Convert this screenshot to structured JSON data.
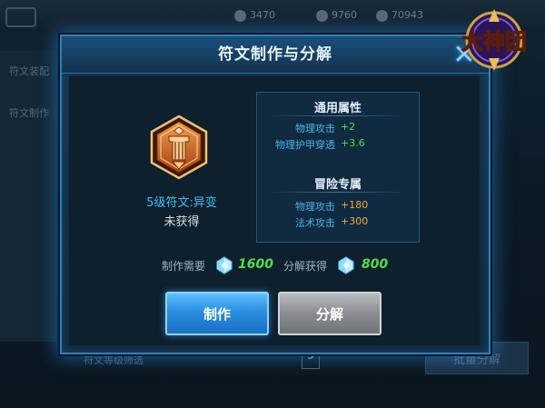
{
  "background": {
    "resources": [
      "3470",
      "9760",
      "70943"
    ],
    "sidebar_items": [
      "符文装配",
      "符文制作"
    ],
    "level_filter_label": "符文等级筛选",
    "level_filter_selected": "5",
    "batch_button": "批量分解"
  },
  "dialog": {
    "title": "符文制作与分解",
    "rune": {
      "name": "5级符文:异变",
      "status": "未获得",
      "icon": "rune-hexagon-icon",
      "color": "#d2691e"
    },
    "general_attributes": {
      "title": "通用属性",
      "rows": [
        {
          "name": "物理攻击",
          "value": "+2"
        },
        {
          "name": "物理护甲穿透",
          "value": "+3.6"
        }
      ]
    },
    "adventure_attributes": {
      "title": "冒险专属",
      "rows": [
        {
          "name": "物理攻击",
          "value": "+180"
        },
        {
          "name": "法术攻击",
          "value": "+300"
        }
      ]
    },
    "cost": {
      "make_label": "制作需要",
      "make_amount": "1600",
      "break_label": "分解获得",
      "break_amount": "800",
      "currency_icon": "crystal-icon"
    },
    "buttons": {
      "make": "制作",
      "break": "分解"
    }
  },
  "logo": {
    "text": "大神团"
  },
  "colors": {
    "accent_blue": "#2f7fc0",
    "value_green": "#4ee04a",
    "value_orange": "#f2a83c",
    "attr_name_blue": "#48b6ec"
  }
}
